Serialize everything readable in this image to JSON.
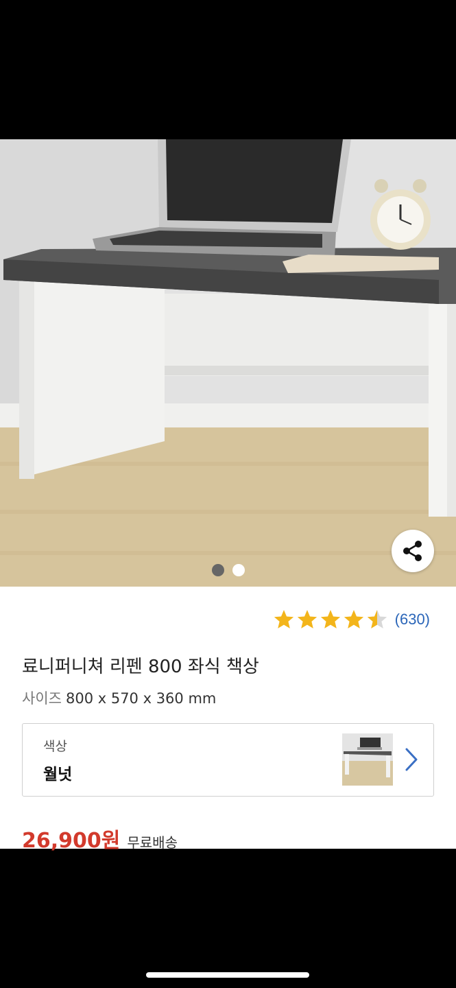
{
  "gallery": {
    "page_count": 2,
    "current_page": 1,
    "share_icon": "share-icon"
  },
  "rating": {
    "stars": 4.5,
    "star_color": "#f3b51b",
    "review_count": "(630)"
  },
  "product": {
    "title": "료니퍼니쳐 리펜 800 좌식 책상",
    "size_label": "사이즈",
    "size_value": "800 x 570 x 360 mm"
  },
  "option": {
    "label": "색상",
    "value": "월넛",
    "chevron_icon": "chevron-right-icon"
  },
  "price": {
    "amount": "26,900원",
    "shipping": "무료배송",
    "color": "#d23a2c"
  }
}
